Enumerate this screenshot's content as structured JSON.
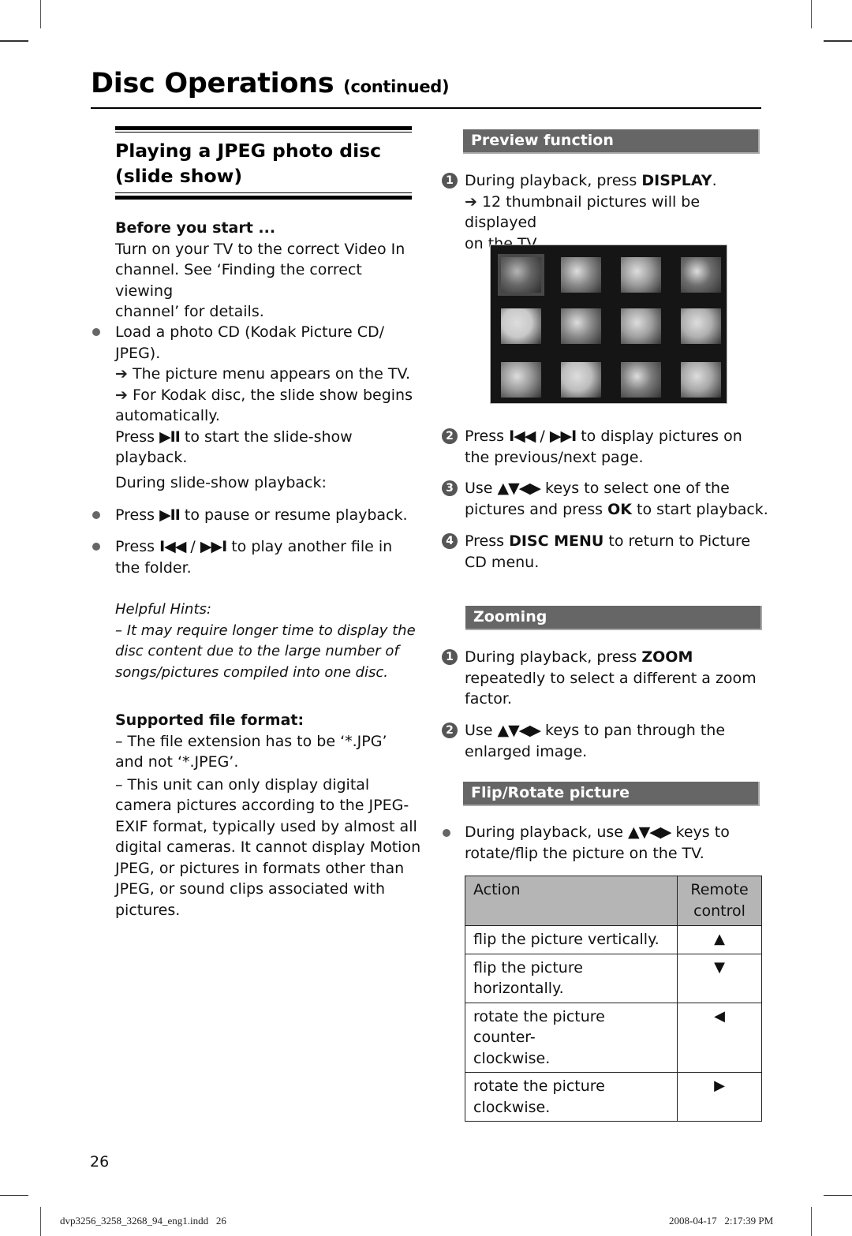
{
  "page": {
    "title": "Disc Operations",
    "title_suffix": "(continued)",
    "page_number": "26"
  },
  "left": {
    "section_title_line1": "Playing a JPEG photo disc",
    "section_title_line2": "(slide show)",
    "before_heading": "Before you start ...",
    "before_text_lines": [
      "Turn on your TV to the correct Video In",
      "channel. See ‘Finding the correct viewing",
      "channel’ for details."
    ],
    "load_lines": [
      "Load a photo CD (Kodak Picture CD/",
      "JPEG)."
    ],
    "result1": "The picture menu appears on the TV.",
    "result2_line1": "For Kodak disc, the slide show begins",
    "result2_line2": "automatically.",
    "press_start_pre": "Press",
    "press_start_post": "to start the slide-show playback.",
    "during_label": "During slide-show playback:",
    "pause_pre": "Press",
    "pause_post": "to pause or resume playback.",
    "skip_pre": "Press",
    "skip_sep": "/",
    "skip_post": "to play another file in",
    "skip_line2": "the folder.",
    "hints_heading": "Helpful Hints:",
    "hints_lines": [
      "–  It may require longer time to display the",
      "disc content due to the large number of",
      "songs/pictures compiled into one disc."
    ],
    "format_heading": "Supported file format:",
    "format_item1_lines": [
      "–  The file extension has to be ‘*.JPG’",
      "and not ‘*.JPEG’."
    ],
    "format_item2_lines": [
      "–  This unit can only display digital",
      "camera pictures according to the JPEG-",
      "EXIF format, typically used by almost all",
      "digital cameras. It cannot display Motion",
      "JPEG, or pictures in formats other than",
      "JPEG, or sound clips associated with",
      "pictures."
    ]
  },
  "right": {
    "preview": {
      "header": "Preview function",
      "step1_num": "1",
      "step1_pre": "During playback, press",
      "step1_key": "DISPLAY",
      "step1_post": ".",
      "step1_result_line1": "12 thumbnail pictures will be displayed",
      "step1_result_line2": "on the TV.",
      "thumbnail_count": 12,
      "thumb_tones": [
        "#7a7a7a",
        "#888",
        "#9a9a9a",
        "#6d6d6d",
        "#c9c9c9",
        "#8a8a8a",
        "#a0a0a0",
        "#b0b0b0",
        "#999",
        "#bdbdbd",
        "#7d7d7d",
        "#a8a8a8"
      ],
      "step2_num": "2",
      "step2_pre": "Press",
      "step2_sep": "/",
      "step2_post": "to display pictures on",
      "step2_line2": "the previous/next page.",
      "step3_num": "3",
      "step3_pre": "Use",
      "step3_post": "keys to select one of the",
      "step3_line2_pre": "pictures and press",
      "step3_key": "OK",
      "step3_line2_post": "to start playback.",
      "step4_num": "4",
      "step4_pre": "Press",
      "step4_key": "DISC MENU",
      "step4_post": "to return to Picture",
      "step4_line2": "CD menu."
    },
    "zooming": {
      "header": "Zooming",
      "step1_num": "1",
      "step1_pre": "During playback, press",
      "step1_key": "ZOOM",
      "step1_line2": "repeatedly to select a different a zoom",
      "step1_line3": "factor.",
      "step2_num": "2",
      "step2_pre": "Use",
      "step2_post": "keys to pan through the",
      "step2_line2": "enlarged image."
    },
    "flip": {
      "header": "Flip/Rotate picture",
      "bullet_pre": "During playback, use",
      "bullet_post": "keys to",
      "bullet_line2": "rotate/flip the picture on the TV.",
      "table": {
        "col_action": "Action",
        "col_remote_line1": "Remote",
        "col_remote_line2": "control",
        "rows": [
          {
            "action_line1": "flip the picture vertically.",
            "action_line2": "",
            "key": "▲"
          },
          {
            "action_line1": "flip the picture horizontally.",
            "action_line2": "",
            "key": "▼"
          },
          {
            "action_line1": "rotate the picture counter-",
            "action_line2": "clockwise.",
            "key": "◀"
          },
          {
            "action_line1": "rotate the picture",
            "action_line2": "clockwise.",
            "key": "▶"
          }
        ]
      }
    }
  },
  "icons": {
    "play_pause": "▶II",
    "prev": "I◀◀",
    "next": "▶▶I",
    "arrow_keys": "▲▼◀▶",
    "result_arrow": "➔"
  },
  "slug": {
    "file": "dvp3256_3258_3268_94_eng1.indd   26",
    "timestamp": "2008-04-17   2:17:39 PM"
  }
}
